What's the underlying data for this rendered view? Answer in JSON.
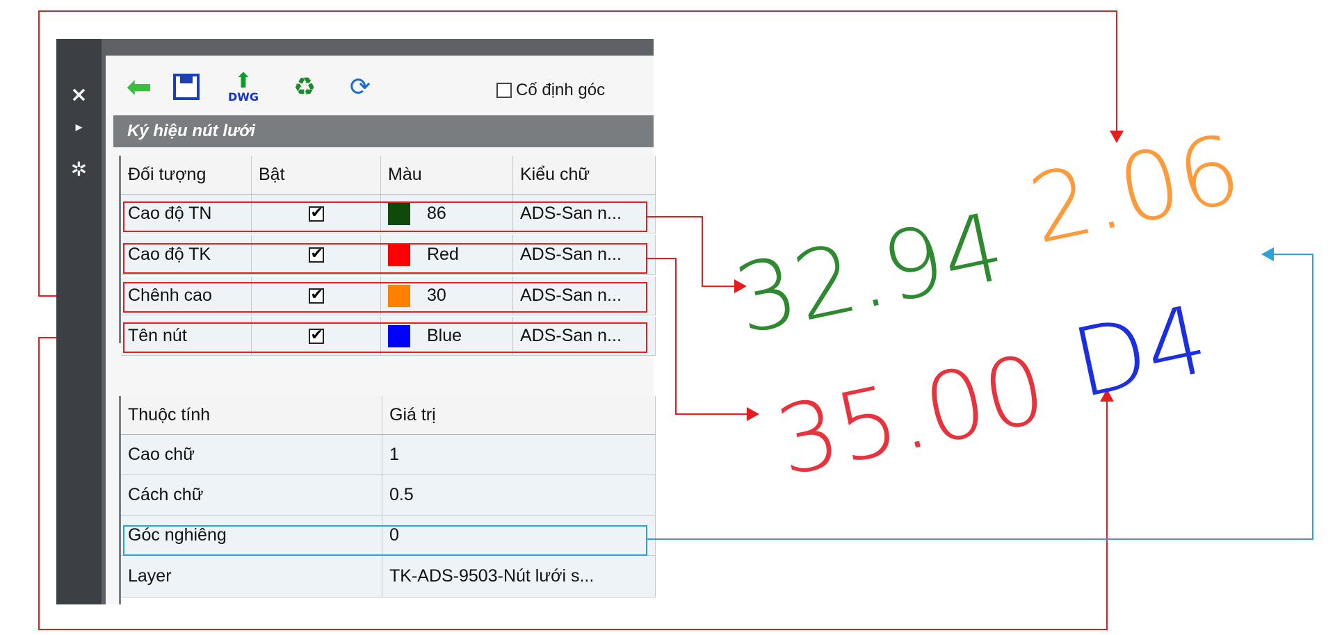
{
  "side_strip": {
    "close_glyph": "×",
    "dock_glyph": "▸",
    "gear_glyph": "✲",
    "close_icon": "close-icon",
    "dock_icon": "dock-icon",
    "settings_icon": "gear-icon"
  },
  "toolbar": {
    "back_icon": "back-arrow-icon",
    "save_icon": "save-icon",
    "dwg_label": "DWG",
    "refresh_icon": "refresh-icon",
    "sync_icon": "sync-icon",
    "fixed_angle_label": "Cố định góc",
    "fixed_angle_checked": false
  },
  "section_title": "Ký hiệu nút lưới",
  "symbol_grid": {
    "headers": [
      "Đối tượng",
      "Bật",
      "Màu",
      "Kiểu chữ"
    ],
    "rows": [
      {
        "object": "Cao độ TN",
        "enabled": true,
        "color_name": "86",
        "color_hex": "#0f4a0a",
        "font": "ADS-San n..."
      },
      {
        "object": "Cao độ TK",
        "enabled": true,
        "color_name": "Red",
        "color_hex": "#ff0000",
        "font": "ADS-San n..."
      },
      {
        "object": "Chênh cao",
        "enabled": true,
        "color_name": "30",
        "color_hex": "#ff8000",
        "font": "ADS-San n..."
      },
      {
        "object": "Tên nút",
        "enabled": true,
        "color_name": "Blue",
        "color_hex": "#0000ff",
        "font": "ADS-San n..."
      }
    ]
  },
  "property_grid": {
    "headers": [
      "Thuộc tính",
      "Giá trị"
    ],
    "rows": [
      {
        "name": "Cao chữ",
        "value": "1"
      },
      {
        "name": "Cách chữ",
        "value": "0.5"
      },
      {
        "name": "Góc nghiêng",
        "value": "0"
      },
      {
        "name": "Layer",
        "value": "TK-ADS-9503-Nút lưới s..."
      }
    ]
  },
  "preview": {
    "natural_elevation": "32.94",
    "design_elevation": "35.00",
    "elevation_difference": "2.06",
    "node_name": "D4"
  },
  "colors": {
    "annotation_red": "#e61d1d",
    "annotation_blue": "#2aa3d8",
    "preview_green": "#2e8a2e",
    "preview_red": "#e8323c",
    "preview_orange": "#ff9a3a",
    "preview_blue": "#1c2fe0"
  }
}
